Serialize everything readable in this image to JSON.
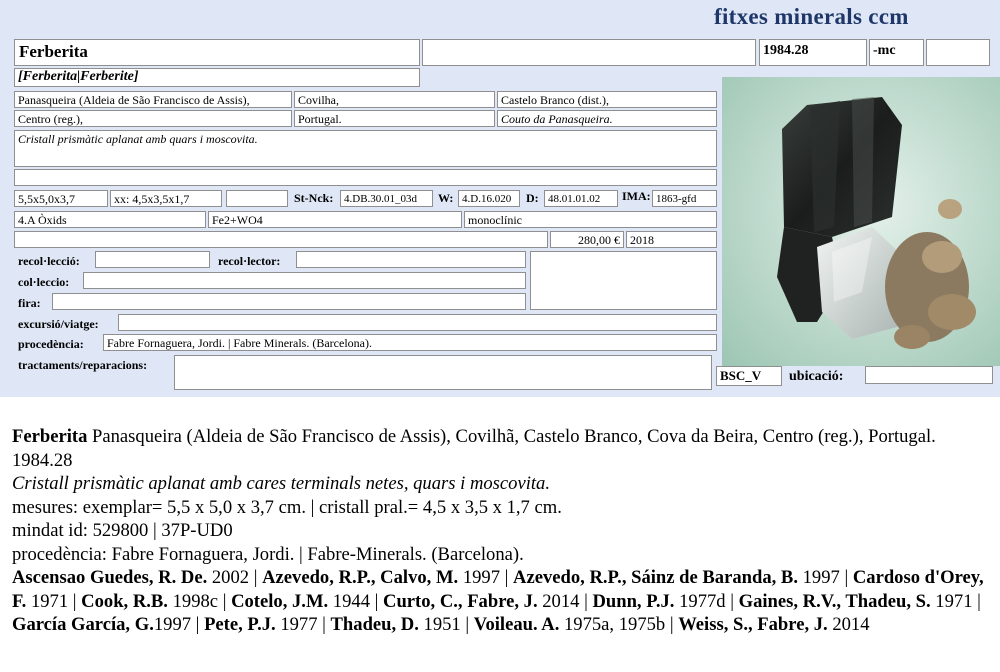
{
  "card": {
    "brand": "fitxes minerals ccm",
    "name": "Ferberita",
    "name_alt": "",
    "catalog_number": "1984.28",
    "suffix": "-mc",
    "extra": "",
    "synonyms": "[Ferberita|Ferberite]",
    "locality": {
      "mine": "Panasqueira (Aldeia de São Francisco de Assis),",
      "municipality": "Covilha,",
      "district": "Castelo Branco (dist.),",
      "region": "Centro (reg.),",
      "country": "Portugal.",
      "subregion": "Couto da Panasqueira."
    },
    "description": "Cristall prismàtic aplanat amb quars i moscovita.",
    "dimensions": "5,5x5,0x3,7",
    "crystal_dimensions": "xx: 4,5x3,5x1,7",
    "dims_extra": "",
    "strunz_label": "St-Nck:",
    "strunz": "4.DB.30.01_03d",
    "w_label": "W:",
    "w_value": "4.D.16.020",
    "d_label": "D:",
    "d_value": "48.01.01.02",
    "ima_label": "IMA:",
    "ima_value": "1863-gfd",
    "class": "4.A Òxids",
    "formula": "Fe2+WO4",
    "system": "monoclínic",
    "price": "280,00 €",
    "year": "2018",
    "labels": {
      "recollection": "recol·lecció:",
      "recollector": "recol·lector:",
      "collection": "col·leccio:",
      "fair": "fira:",
      "excursion": "excursió/viatge:",
      "provenance": "procedència:",
      "treatments": "tractaments/reparacions:",
      "location": "ubicació:"
    },
    "provenance_value": "Fabre Fornaguera, Jordi. | Fabre Minerals. (Barcelona).",
    "storage_code": "BSC_V"
  },
  "description_block": {
    "title_name": "Ferberita",
    "title_rest": " Panasqueira (Aldeia de São Francisco de Assis), Covilhã, Castelo Branco, Cova da Beira, Centro (reg.), Portugal. 1984.28",
    "description": "Cristall prismàtic aplanat amb cares terminals netes, quars i moscovita.",
    "measures": "mesures: exemplar= 5,5 x 5,0 x 3,7 cm. | cristall pral.= 4,5 x 3,5 x 1,7 cm.",
    "mindat": "mindat id: 529800 | 37P-UD0",
    "provenance": "procedència: Fabre Fornaguera, Jordi. | Fabre-Minerals. (Barcelona).",
    "references": [
      {
        "author": "Ascensao Guedes, R. De.",
        "year": " 2002 | "
      },
      {
        "author": "Azevedo, R.P., Calvo, M.",
        "year": " 1997 | "
      },
      {
        "author": "Azevedo, R.P., Sáinz de Baranda, B.",
        "year": " 1997 | "
      },
      {
        "author": "Cardoso d'Orey, F.",
        "year": " 1971 | "
      },
      {
        "author": "Cook, R.B.",
        "year": " 1998c |  "
      },
      {
        "author": "Cotelo, J.M.",
        "year": " 1944 | "
      },
      {
        "author": "Curto, C., Fabre, J.",
        "year": " 2014 | "
      },
      {
        "author": "Dunn, P.J.",
        "year": " 1977d | "
      },
      {
        "author": "Gaines, R.V., Thadeu, S.",
        "year": " 1971 | "
      },
      {
        "author": "García García, G.",
        "year": "1997 | "
      },
      {
        "author": "Pete, P.J.",
        "year": " 1977 | "
      },
      {
        "author": "Thadeu, D.",
        "year": " 1951 | "
      },
      {
        "author": "Voileau. A.",
        "year": " 1975a, 1975b | "
      },
      {
        "author": "Weiss, S., Fabre, J.",
        "year": " 2014"
      }
    ]
  }
}
